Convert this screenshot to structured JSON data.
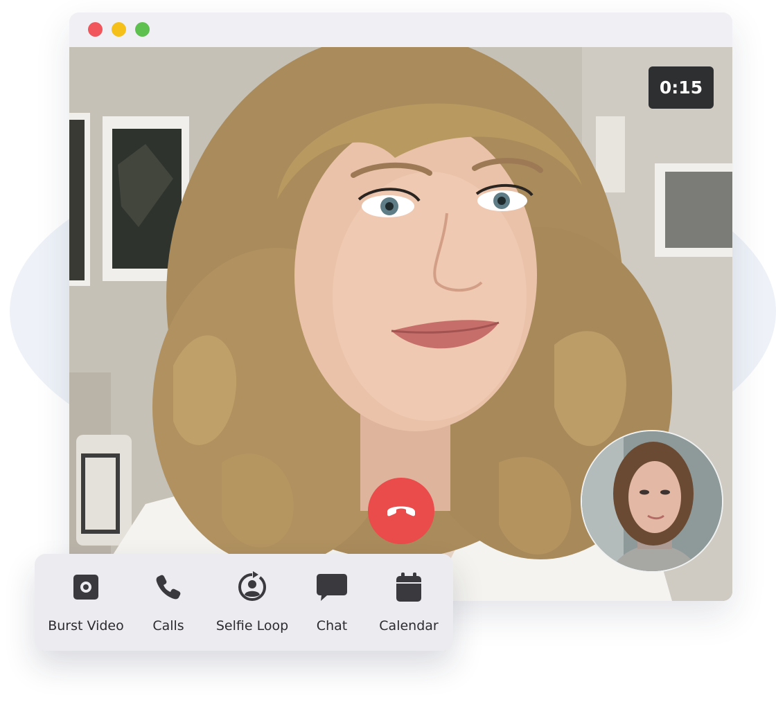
{
  "window": {
    "controls": {
      "close_color": "#f0565b",
      "minimize_color": "#f6c01a",
      "maximize_color": "#5ec04e"
    }
  },
  "call": {
    "timer": "0:15",
    "end_call_icon": "phone-hangup-icon",
    "end_call_color": "#ea4b4b"
  },
  "toolbar": {
    "items": [
      {
        "label": "Burst Video",
        "icon": "camera-record-icon"
      },
      {
        "label": "Calls",
        "icon": "phone-icon"
      },
      {
        "label": "Selfie Loop",
        "icon": "refresh-user-icon"
      },
      {
        "label": "Chat",
        "icon": "chat-bubble-icon"
      },
      {
        "label": "Calendar",
        "icon": "calendar-icon"
      }
    ]
  }
}
